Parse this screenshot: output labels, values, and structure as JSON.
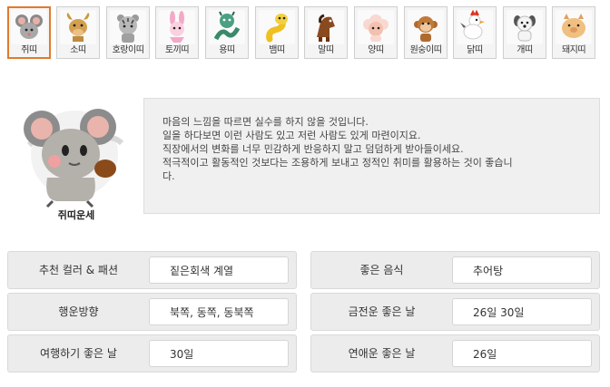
{
  "zodiac_tabs": [
    {
      "label": "쥐띠",
      "icon": "rat-icon",
      "selected": true
    },
    {
      "label": "소띠",
      "icon": "ox-icon",
      "selected": false
    },
    {
      "label": "호랑이띠",
      "icon": "tiger-icon",
      "selected": false
    },
    {
      "label": "토끼띠",
      "icon": "rabbit-icon",
      "selected": false
    },
    {
      "label": "용띠",
      "icon": "dragon-icon",
      "selected": false
    },
    {
      "label": "뱀띠",
      "icon": "snake-icon",
      "selected": false
    },
    {
      "label": "말띠",
      "icon": "horse-icon",
      "selected": false
    },
    {
      "label": "양띠",
      "icon": "sheep-icon",
      "selected": false
    },
    {
      "label": "원숭이띠",
      "icon": "monkey-icon",
      "selected": false
    },
    {
      "label": "닭띠",
      "icon": "rooster-icon",
      "selected": false
    },
    {
      "label": "개띠",
      "icon": "dog-icon",
      "selected": false
    },
    {
      "label": "돼지띠",
      "icon": "pig-icon",
      "selected": false
    }
  ],
  "fortune": {
    "caption": "쥐띠운세",
    "lines": [
      "마음의 느낌을 따르면 실수를 하지 않을 것입니다.",
      "일을 하다보면 이런 사람도 있고 저런 사람도 있게 마련이지요.",
      "직장에서의 변화를 너무 민감하게 반응하지 말고 덤덤하게 받아들이세요.",
      "적극적이고 활동적인 것보다는 조용하게 보내고 정적인 취미를 활용하는 것이 좋습니",
      "다."
    ]
  },
  "info": {
    "color": {
      "label": "추천 컬러 & 패션",
      "value": "짙은회색 계열"
    },
    "food": {
      "label": "좋은 음식",
      "value": "추어탕"
    },
    "direction": {
      "label": "행운방향",
      "value": "북쪽, 동쪽, 동북쪽"
    },
    "money_day": {
      "label": "금전운 좋은 날",
      "value": "26일 30일"
    },
    "travel_day": {
      "label": "여행하기 좋은 날",
      "value": "30일"
    },
    "love_day": {
      "label": "연애운 좋은 날",
      "value": "26일"
    }
  },
  "colors": {
    "selected_border": "#e07a2e",
    "panel_bg": "#ececec",
    "fortune_bg": "#f0f0f0"
  }
}
